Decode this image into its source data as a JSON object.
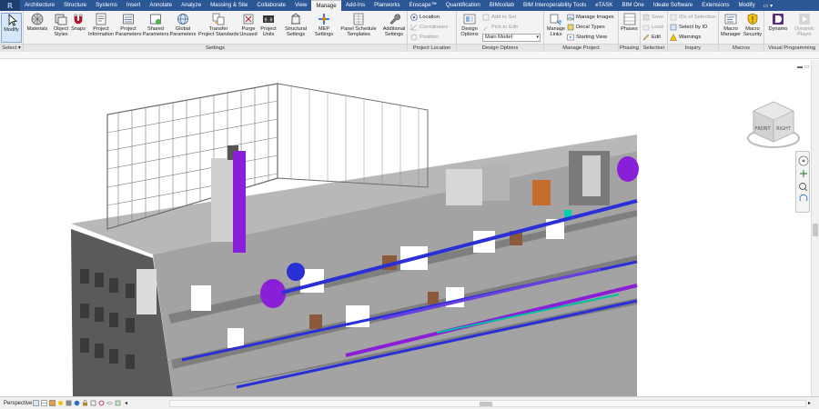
{
  "app": {
    "logo_letter": "R"
  },
  "tabs": [
    "Architecture",
    "Structure",
    "Systems",
    "Insert",
    "Annotate",
    "Analyze",
    "Massing & Site",
    "Collaborate",
    "View",
    "Manage",
    "Add-Ins",
    "Planworks",
    "Enscape™",
    "Quantification",
    "BIMcollab",
    "BIM Interoperability Tools",
    "eTASK",
    "BIM One",
    "Ideate Software",
    "Extensions",
    "Modify"
  ],
  "active_tab": "Manage",
  "tab_extra": "▭ ▾",
  "ribbon": {
    "select": {
      "modify": "Modify",
      "title": "Select ▾"
    },
    "settings": {
      "materials": "Materials",
      "object_styles_1": "Object",
      "object_styles_2": "Styles",
      "snaps": "Snaps",
      "project_info_1": "Project",
      "project_info_2": "Information",
      "project_params_1": "Project",
      "project_params_2": "Parameters",
      "shared_params_1": "Shared",
      "shared_params_2": "Parameters",
      "global_params_1": "Global",
      "global_params_2": "Parameters",
      "transfer_1": "Transfer",
      "transfer_2": "Project Standards",
      "purge_1": "Purge",
      "purge_2": "Unused",
      "units_1": "Project",
      "units_2": "Units",
      "structural_1": "Structural",
      "structural_2": "Settings",
      "mep_1": "MEP",
      "mep_2": "Settings",
      "panel_1": "Panel Schedule",
      "panel_2": "Templates",
      "additional_1": "Additional",
      "additional_2": "Settings",
      "title": "Settings"
    },
    "location": {
      "location": "Location",
      "coordinates": "Coordinates",
      "position": "Position",
      "title": "Project Location"
    },
    "design_options": {
      "design_1": "Design",
      "design_2": "Options",
      "add_to_set": "Add to Set",
      "pick_to_edit": "Pick to Edit",
      "main_model": "Main Model",
      "title": "Design Options"
    },
    "manage_project": {
      "manage_links_1": "Manage",
      "manage_links_2": "Links",
      "manage_images": "Manage Images",
      "decal_types": "Decal Types",
      "starting_view": "Starting View",
      "title": "Manage Project"
    },
    "phasing": {
      "phases": "Phases",
      "title": "Phasing"
    },
    "selection": {
      "save": "Save",
      "load": "Load",
      "edit": "Edit",
      "title": "Selection"
    },
    "inquiry": {
      "ids": "IDs of Selection",
      "select_by_id": "Select by ID",
      "warnings": "Warnings",
      "title": "Inquiry"
    },
    "macros": {
      "manager_1": "Macro",
      "manager_2": "Manager",
      "security_1": "Macro",
      "security_2": "Security",
      "title": "Macros"
    },
    "visual": {
      "dynamo": "Dynamo",
      "player_1": "Dynamic",
      "player_2": "Player",
      "title": "Visual Programming"
    }
  },
  "viewport": {
    "controls": "▬ ▭ ✕",
    "cube_left": "FRONT",
    "cube_right": "RIGHT"
  },
  "statusbar": {
    "view_type": "Perspective",
    "scroll_left": "◂",
    "scroll_right": "▸"
  },
  "colors": {
    "accent": "#2b5797",
    "duct_blue": "#2a2fd6",
    "equipment_purple": "#8a1fd8",
    "floor_gray": "#9e9e9e"
  }
}
